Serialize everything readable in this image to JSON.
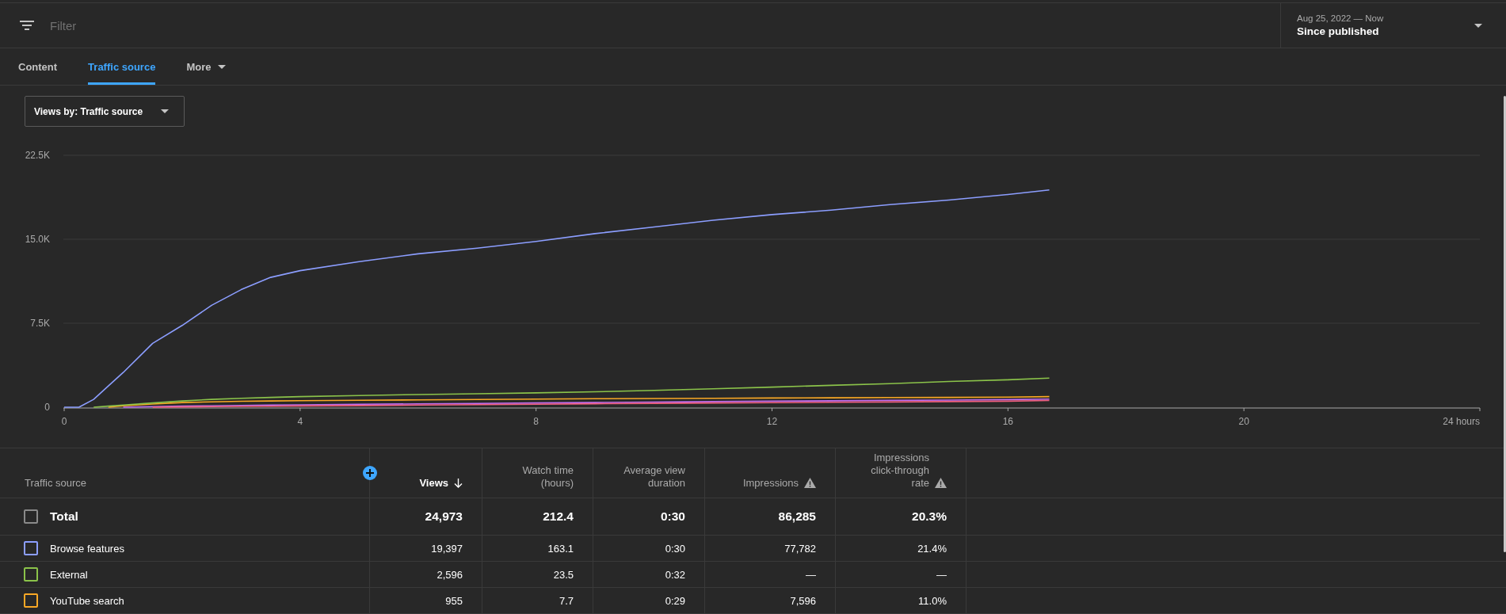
{
  "filter_bar": {
    "placeholder": "Filter"
  },
  "date_range": {
    "range": "Aug 25, 2022 — Now",
    "label": "Since published"
  },
  "tabs": [
    {
      "label": "Content",
      "selected": false,
      "kind": "tab"
    },
    {
      "label": "Traffic source",
      "selected": true,
      "kind": "tab"
    },
    {
      "label": "More",
      "selected": false,
      "kind": "menu"
    }
  ],
  "metric_dropdown": {
    "value": "Views by: Traffic source"
  },
  "chart": {
    "chart_data": {
      "type": "line",
      "x": [
        0,
        0.25,
        0.5,
        0.75,
        1,
        1.5,
        2,
        2.5,
        3,
        3.5,
        4,
        5,
        6,
        7,
        8,
        9,
        10,
        11,
        12,
        13,
        14,
        15,
        16,
        16.7
      ],
      "series": [
        {
          "color": "#8c9eff",
          "values": [
            0,
            0,
            700,
            1900,
            3100,
            5700,
            7300,
            9100,
            10500,
            11600,
            12200,
            13000,
            13700,
            14200,
            14800,
            15500,
            16100,
            16700,
            17200,
            17600,
            18100,
            18500,
            19000,
            19400
          ]
        },
        {
          "color": "#8bc34a",
          "values": [
            null,
            null,
            0,
            100,
            200,
            380,
            560,
            700,
            800,
            880,
            950,
            1050,
            1130,
            1200,
            1280,
            1380,
            1500,
            1650,
            1800,
            1950,
            2100,
            2300,
            2450,
            2600
          ]
        },
        {
          "color": "#f9a825",
          "values": [
            null,
            null,
            null,
            0,
            120,
            280,
            420,
            480,
            530,
            560,
            580,
            620,
            650,
            690,
            720,
            760,
            780,
            800,
            820,
            840,
            860,
            880,
            900,
            950
          ]
        },
        {
          "color": "#f0607f",
          "values": [
            null,
            null,
            null,
            null,
            null,
            0,
            30,
            50,
            70,
            90,
            110,
            150,
            190,
            230,
            270,
            310,
            350,
            380,
            410,
            440,
            470,
            500,
            540,
            600
          ]
        },
        {
          "color": "#c26df2",
          "values": [
            null,
            null,
            null,
            null,
            0,
            60,
            100,
            130,
            160,
            190,
            210,
            260,
            300,
            340,
            380,
            420,
            460,
            500,
            540,
            570,
            610,
            640,
            680,
            720
          ]
        }
      ],
      "xlim": [
        0,
        24
      ],
      "ylim": [
        0,
        22500
      ],
      "xticks": [
        0,
        4,
        8,
        12,
        16,
        20,
        {
          "value": 24,
          "label": "24 hours"
        }
      ],
      "yticks": [
        0,
        {
          "value": 7500,
          "label": "7.5K"
        },
        {
          "value": 15000,
          "label": "15.0K"
        },
        {
          "value": 22500,
          "label": "22.5K"
        }
      ]
    }
  },
  "table": {
    "columns": [
      {
        "label": "Traffic source",
        "sorted": false,
        "warning": false
      },
      {
        "label": "Views",
        "sorted": true,
        "warning": false
      },
      {
        "label": "Watch time (hours)",
        "sorted": false,
        "warning": false
      },
      {
        "label": "Average view duration",
        "sorted": false,
        "warning": false
      },
      {
        "label": "Impressions",
        "sorted": false,
        "warning": true
      },
      {
        "label": "Impressions click-through rate",
        "sorted": false,
        "warning": true
      }
    ],
    "total": {
      "checked": false,
      "cells": [
        "Total",
        "24,973",
        "212.4",
        "0:30",
        "86,285",
        "20.3%"
      ]
    },
    "rows": [
      {
        "color": "#8c9eff",
        "checked": false,
        "cells": [
          "Browse features",
          "19,397",
          "163.1",
          "0:30",
          "77,782",
          "21.4%"
        ]
      },
      {
        "color": "#8bc34a",
        "checked": false,
        "cells": [
          "External",
          "2,596",
          "23.5",
          "0:32",
          "—",
          "—"
        ]
      },
      {
        "color": "#f9a825",
        "checked": false,
        "cells": [
          "YouTube search",
          "955",
          "7.7",
          "0:29",
          "7,596",
          "11.0%"
        ]
      }
    ]
  }
}
